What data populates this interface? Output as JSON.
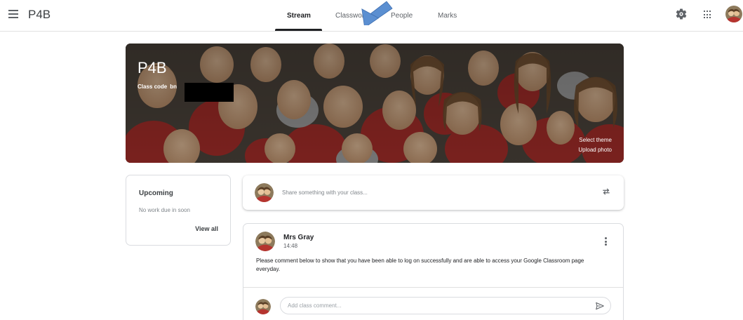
{
  "header": {
    "class_name": "P4B",
    "tabs": [
      {
        "label": "Stream",
        "active": true
      },
      {
        "label": "Classwork",
        "active": false
      },
      {
        "label": "People",
        "active": false
      },
      {
        "label": "Marks",
        "active": false
      }
    ],
    "icons": [
      "menu-icon",
      "gear-icon",
      "apps-icon",
      "account-avatar"
    ]
  },
  "banner": {
    "title": "P4B",
    "class_code_label": "Class code",
    "class_code_visible": "bn",
    "select_theme": "Select theme",
    "upload_photo": "Upload photo"
  },
  "upcoming": {
    "title": "Upcoming",
    "empty_text": "No work due in soon",
    "view_all": "View all"
  },
  "share": {
    "placeholder": "Share something with your class..."
  },
  "post": {
    "author": "Mrs Gray",
    "time": "14:48",
    "body": "Please comment below to show that you have been able to log on successfully and are able to access your Google Classroom page everyday.",
    "comment_placeholder": "Add class comment..."
  },
  "colors": {
    "annotation_arrow": "#5b8fd1",
    "active_tab_underline": "#202124"
  }
}
